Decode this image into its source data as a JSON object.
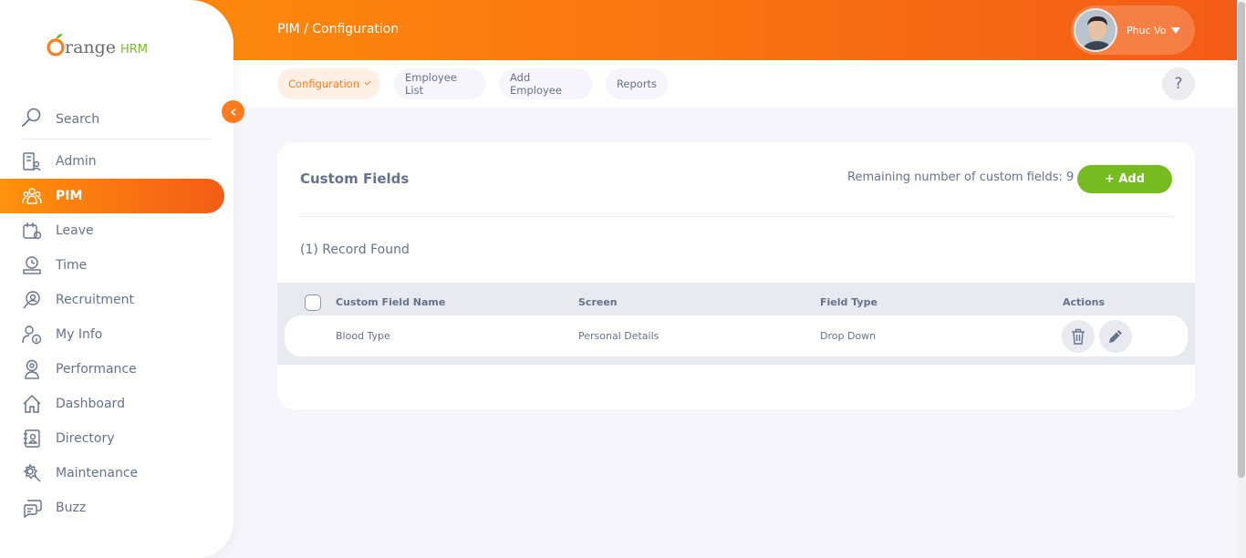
{
  "header": {
    "breadcrumb": "PIM / Configuration",
    "user_name": "Phuc Vo"
  },
  "brand": {
    "logo_main": "range",
    "logo_suffix": "HRM",
    "accent": "#ff7b1d",
    "green": "#76bc21"
  },
  "topnav": {
    "items": [
      {
        "label": "Configuration",
        "active": true
      },
      {
        "label": "Employee List"
      },
      {
        "label": "Add Employee"
      },
      {
        "label": "Reports"
      }
    ],
    "help": "?"
  },
  "sidebar": {
    "search_label": "Search",
    "items": [
      {
        "label": "Admin",
        "icon": "admin-icon"
      },
      {
        "label": "PIM",
        "icon": "pim-icon",
        "active": true
      },
      {
        "label": "Leave",
        "icon": "leave-icon"
      },
      {
        "label": "Time",
        "icon": "time-icon"
      },
      {
        "label": "Recruitment",
        "icon": "recruitment-icon"
      },
      {
        "label": "My Info",
        "icon": "my-info-icon"
      },
      {
        "label": "Performance",
        "icon": "performance-icon"
      },
      {
        "label": "Dashboard",
        "icon": "dashboard-icon"
      },
      {
        "label": "Directory",
        "icon": "directory-icon"
      },
      {
        "label": "Maintenance",
        "icon": "maintenance-icon"
      },
      {
        "label": "Buzz",
        "icon": "buzz-icon"
      }
    ]
  },
  "main": {
    "title": "Custom Fields",
    "remaining": "Remaining number of custom fields: 9",
    "add_label": "+ Add",
    "records": "(1) Record Found",
    "table": {
      "columns": [
        "Custom Field Name",
        "Screen",
        "Field Type",
        "Actions"
      ],
      "rows": [
        {
          "name": "Blood Type",
          "screen": "Personal Details",
          "type": "Drop Down"
        }
      ]
    }
  }
}
